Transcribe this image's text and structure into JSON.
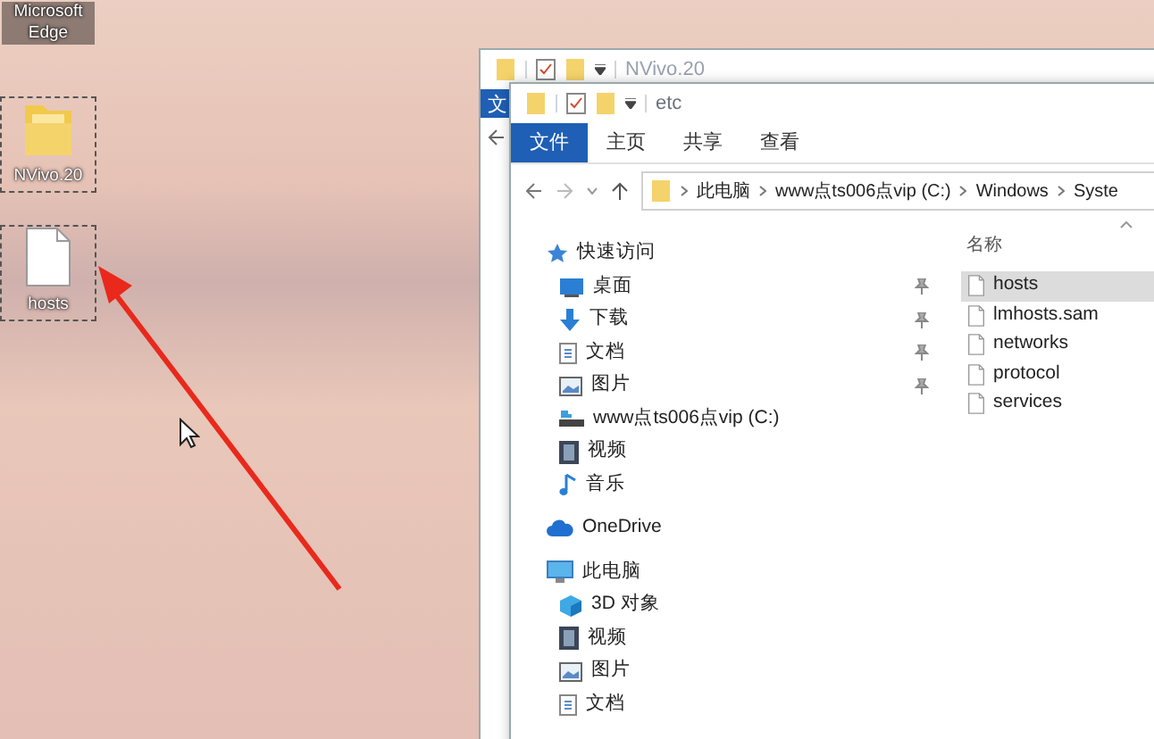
{
  "desktop_icons": [
    {
      "label": "Microsoft Edge",
      "kind": "label",
      "selected": false
    },
    {
      "label": "NVivo.20",
      "kind": "folder",
      "selected": true
    },
    {
      "label": "hosts",
      "kind": "file",
      "selected": true
    }
  ],
  "back_window": {
    "title": "NVivo.20",
    "ribbon_tab": "文"
  },
  "front_window": {
    "title": "etc",
    "ribbon_tabs": [
      {
        "label": "文件",
        "selected": true
      },
      {
        "label": "主页",
        "selected": false
      },
      {
        "label": "共享",
        "selected": false
      },
      {
        "label": "查看",
        "selected": false
      }
    ],
    "address_path": [
      "此电脑",
      "www点ts006点vip (C:)",
      "Windows",
      "Syste"
    ],
    "nav": [
      {
        "label": "快速访问",
        "kind": "star",
        "children": [
          {
            "label": "桌面",
            "kind": "desktop",
            "pinned": true
          },
          {
            "label": "下载",
            "kind": "download",
            "pinned": true
          },
          {
            "label": "文档",
            "kind": "document",
            "pinned": true
          },
          {
            "label": "图片",
            "kind": "picture",
            "pinned": true
          },
          {
            "label": "www点ts006点vip (C:)",
            "kind": "drive",
            "pinned": false
          },
          {
            "label": "视频",
            "kind": "video",
            "pinned": false
          },
          {
            "label": "音乐",
            "kind": "music",
            "pinned": false
          }
        ]
      },
      {
        "label": "OneDrive",
        "kind": "cloud"
      },
      {
        "label": "此电脑",
        "kind": "computer",
        "children": [
          {
            "label": "3D 对象",
            "kind": "cube",
            "pinned": false
          },
          {
            "label": "视频",
            "kind": "video",
            "pinned": false
          },
          {
            "label": "图片",
            "kind": "picture",
            "pinned": false
          },
          {
            "label": "文档",
            "kind": "document",
            "pinned": false
          }
        ]
      }
    ],
    "list_header": "名称",
    "files": [
      {
        "name": "hosts",
        "selected": true
      },
      {
        "name": "lmhosts.sam",
        "selected": false
      },
      {
        "name": "networks",
        "selected": false
      },
      {
        "name": "protocol",
        "selected": false
      },
      {
        "name": "services",
        "selected": false
      }
    ]
  }
}
